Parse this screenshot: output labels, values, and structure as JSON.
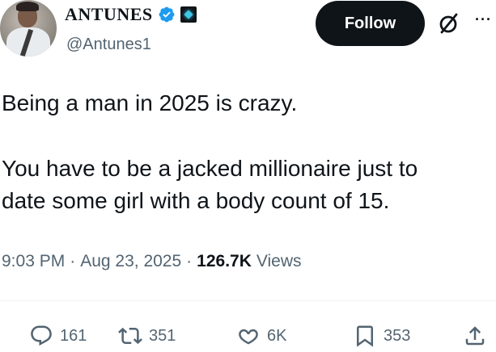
{
  "author": {
    "display_name": "ANTUNES",
    "handle": "@Antunes1",
    "verified_icon": "verified-badge-icon",
    "affiliate_icon": "affiliate-badge-icon",
    "brand_blue": "#1d9bf0"
  },
  "header": {
    "follow_label": "Follow",
    "grok_icon": "grok-icon",
    "more_icon": "more-options-icon",
    "more_label": "···"
  },
  "tweet": {
    "line1": "Being a man in 2025 is crazy.",
    "line2": "You have to be a jacked millionaire just to",
    "line3": "date some girl with a body count of 15."
  },
  "meta": {
    "time": "9:03 PM",
    "sep1": "·",
    "date": "Aug 23, 2025",
    "sep2": "·",
    "views_count": "126.7K",
    "views_label": "Views"
  },
  "actions": {
    "replies": "161",
    "reposts": "351",
    "likes": "6K",
    "bookmarks": "353"
  },
  "colors": {
    "text": "#0f1419",
    "muted": "#536471",
    "button_bg": "#0f1419",
    "button_text": "#ffffff"
  }
}
